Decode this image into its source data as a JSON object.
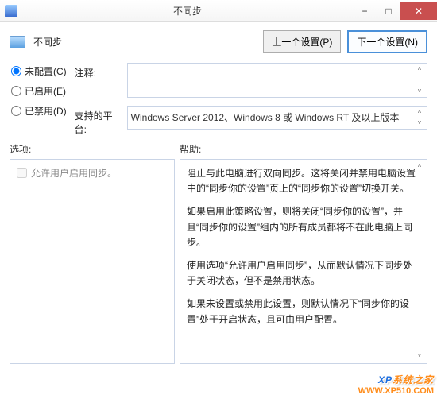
{
  "window": {
    "title": "不同步",
    "min": "−",
    "max": "□",
    "close": "✕"
  },
  "header": {
    "page_title": "不同步",
    "prev_btn": "上一个设置(P)",
    "next_btn": "下一个设置(N)"
  },
  "radios": {
    "not_configured": "未配置(C)",
    "enabled": "已启用(E)",
    "disabled": "已禁用(D)"
  },
  "fields": {
    "comment_label": "注释:",
    "comment_value": "",
    "platform_label": "支持的平台:",
    "platform_value": "Windows Server 2012、Windows 8 或 Windows RT 及以上版本"
  },
  "sections": {
    "options_label": "选项:",
    "help_label": "帮助:"
  },
  "options": {
    "allow_user_sync": "允许用户启用同步。"
  },
  "help": {
    "p1": "阻止与此电脑进行双向同步。这将关闭并禁用电脑设置中的“同步你的设置”页上的“同步你的设置”切换开关。",
    "p2": "如果启用此策略设置，则将关闭“同步你的设置”，并且“同步你的设置”组内的所有成员都将不在此电脑上同步。",
    "p3": "使用选项“允许用户启用同步”，从而默认情况下同步处于关闭状态，但不是禁用状态。",
    "p4": "如果未设置或禁用此设置，则默认情况下“同步你的设置”处于开启状态，且可由用户配置。"
  },
  "watermark": {
    "brand_xp": "XP",
    "brand_cn": "系统之家",
    "url": "WWW.XP510.COM"
  },
  "spin": {
    "up": "˄",
    "down": "˅"
  }
}
